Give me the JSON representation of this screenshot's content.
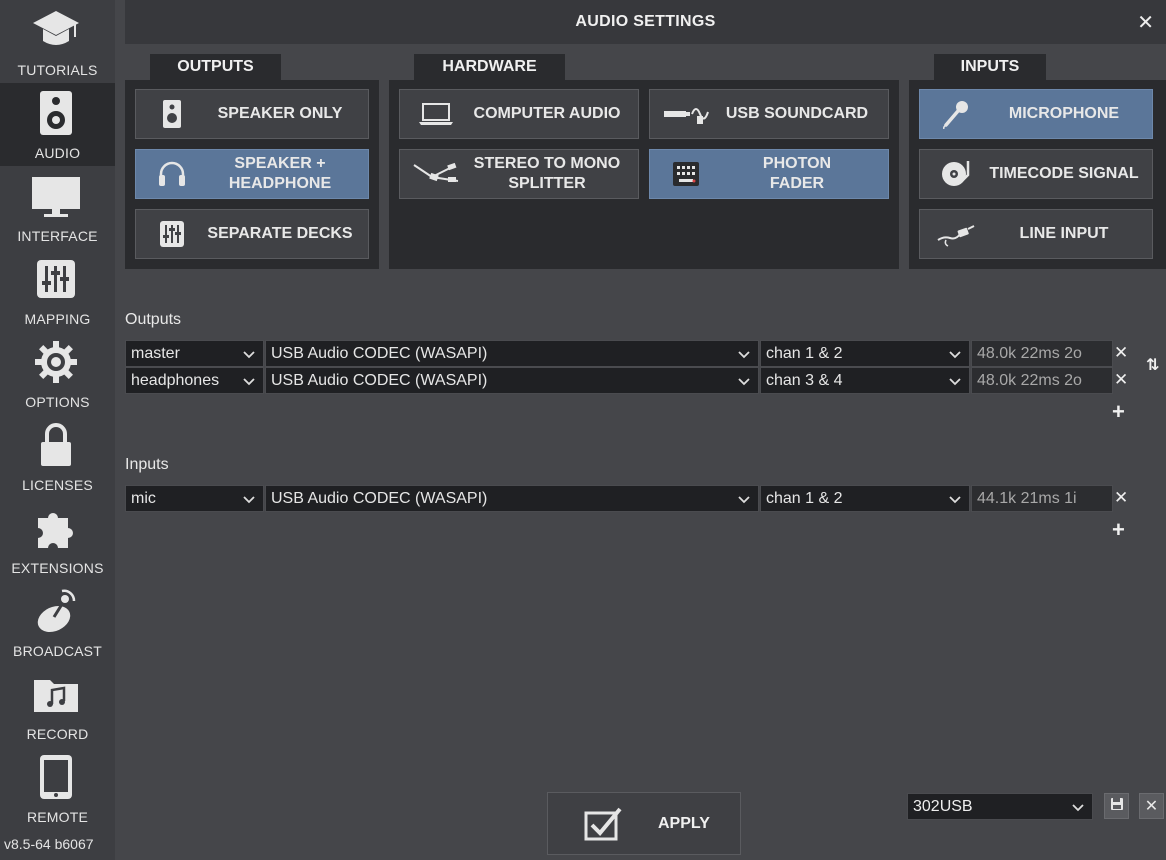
{
  "sidebar": {
    "items": [
      {
        "label": "TUTORIALS",
        "icon": "graduation-cap-icon"
      },
      {
        "label": "AUDIO",
        "icon": "speaker-icon",
        "active": true
      },
      {
        "label": "INTERFACE",
        "icon": "monitor-icon"
      },
      {
        "label": "MAPPING",
        "icon": "sliders-icon"
      },
      {
        "label": "OPTIONS",
        "icon": "gear-icon"
      },
      {
        "label": "LICENSES",
        "icon": "lock-icon"
      },
      {
        "label": "EXTENSIONS",
        "icon": "puzzle-icon"
      },
      {
        "label": "BROADCAST",
        "icon": "satellite-dish-icon"
      },
      {
        "label": "RECORD",
        "icon": "music-folder-icon"
      },
      {
        "label": "REMOTE",
        "icon": "tablet-icon"
      }
    ],
    "version": "v8.5-64 b6067"
  },
  "header": {
    "title": "AUDIO SETTINGS",
    "close": "✕"
  },
  "outputs_panel": {
    "tab": "OUTPUTS",
    "buttons": [
      {
        "label": "SPEAKER ONLY",
        "icon": "speaker-icon"
      },
      {
        "label": "SPEAKER +\nHEADPHONE",
        "icon": "headphone-icon",
        "selected": true
      },
      {
        "label": "SEPARATE DECKS",
        "icon": "mixer-icon"
      }
    ]
  },
  "hardware_panel": {
    "tab": "HARDWARE",
    "buttons": [
      {
        "label": "COMPUTER AUDIO",
        "icon": "laptop-icon"
      },
      {
        "label": "USB SOUNDCARD",
        "icon": "usb-cable-icon"
      },
      {
        "label": "STEREO TO MONO\nSPLITTER",
        "icon": "splitter-cable-icon"
      },
      {
        "label": "PHOTON\nFADER",
        "icon": "fader-device-icon",
        "selected": true
      }
    ]
  },
  "inputs_panel": {
    "tab": "INPUTS",
    "buttons": [
      {
        "label": "MICROPHONE",
        "icon": "microphone-icon",
        "selected": true
      },
      {
        "label": "TIMECODE SIGNAL",
        "icon": "turntable-icon"
      },
      {
        "label": "LINE INPUT",
        "icon": "jack-cable-icon"
      }
    ]
  },
  "outputs": {
    "label": "Outputs",
    "rows": [
      {
        "name": "master",
        "device": "USB Audio CODEC  (WASAPI)",
        "channels": "chan 1 & 2",
        "info": "48.0k 22ms 2o"
      },
      {
        "name": "headphones",
        "device": "USB Audio CODEC  (WASAPI)",
        "channels": "chan 3 & 4",
        "info": "48.0k 22ms 2o"
      }
    ]
  },
  "inputs": {
    "label": "Inputs",
    "rows": [
      {
        "name": "mic",
        "device": "USB Audio CODEC  (WASAPI)",
        "channels": "chan 1 & 2",
        "info": "44.1k 21ms 1i"
      }
    ]
  },
  "controls": {
    "remove": "✕",
    "add": "+",
    "chevron": "⌄",
    "swap": "⇅"
  },
  "footer": {
    "apply_label": "APPLY",
    "preset_value": "302USB",
    "save_icon": "floppy-disk-icon",
    "delete": "✕"
  },
  "colors": {
    "background": "#45464a",
    "panel": "#2a2b2e",
    "selected": "#5b7699"
  }
}
